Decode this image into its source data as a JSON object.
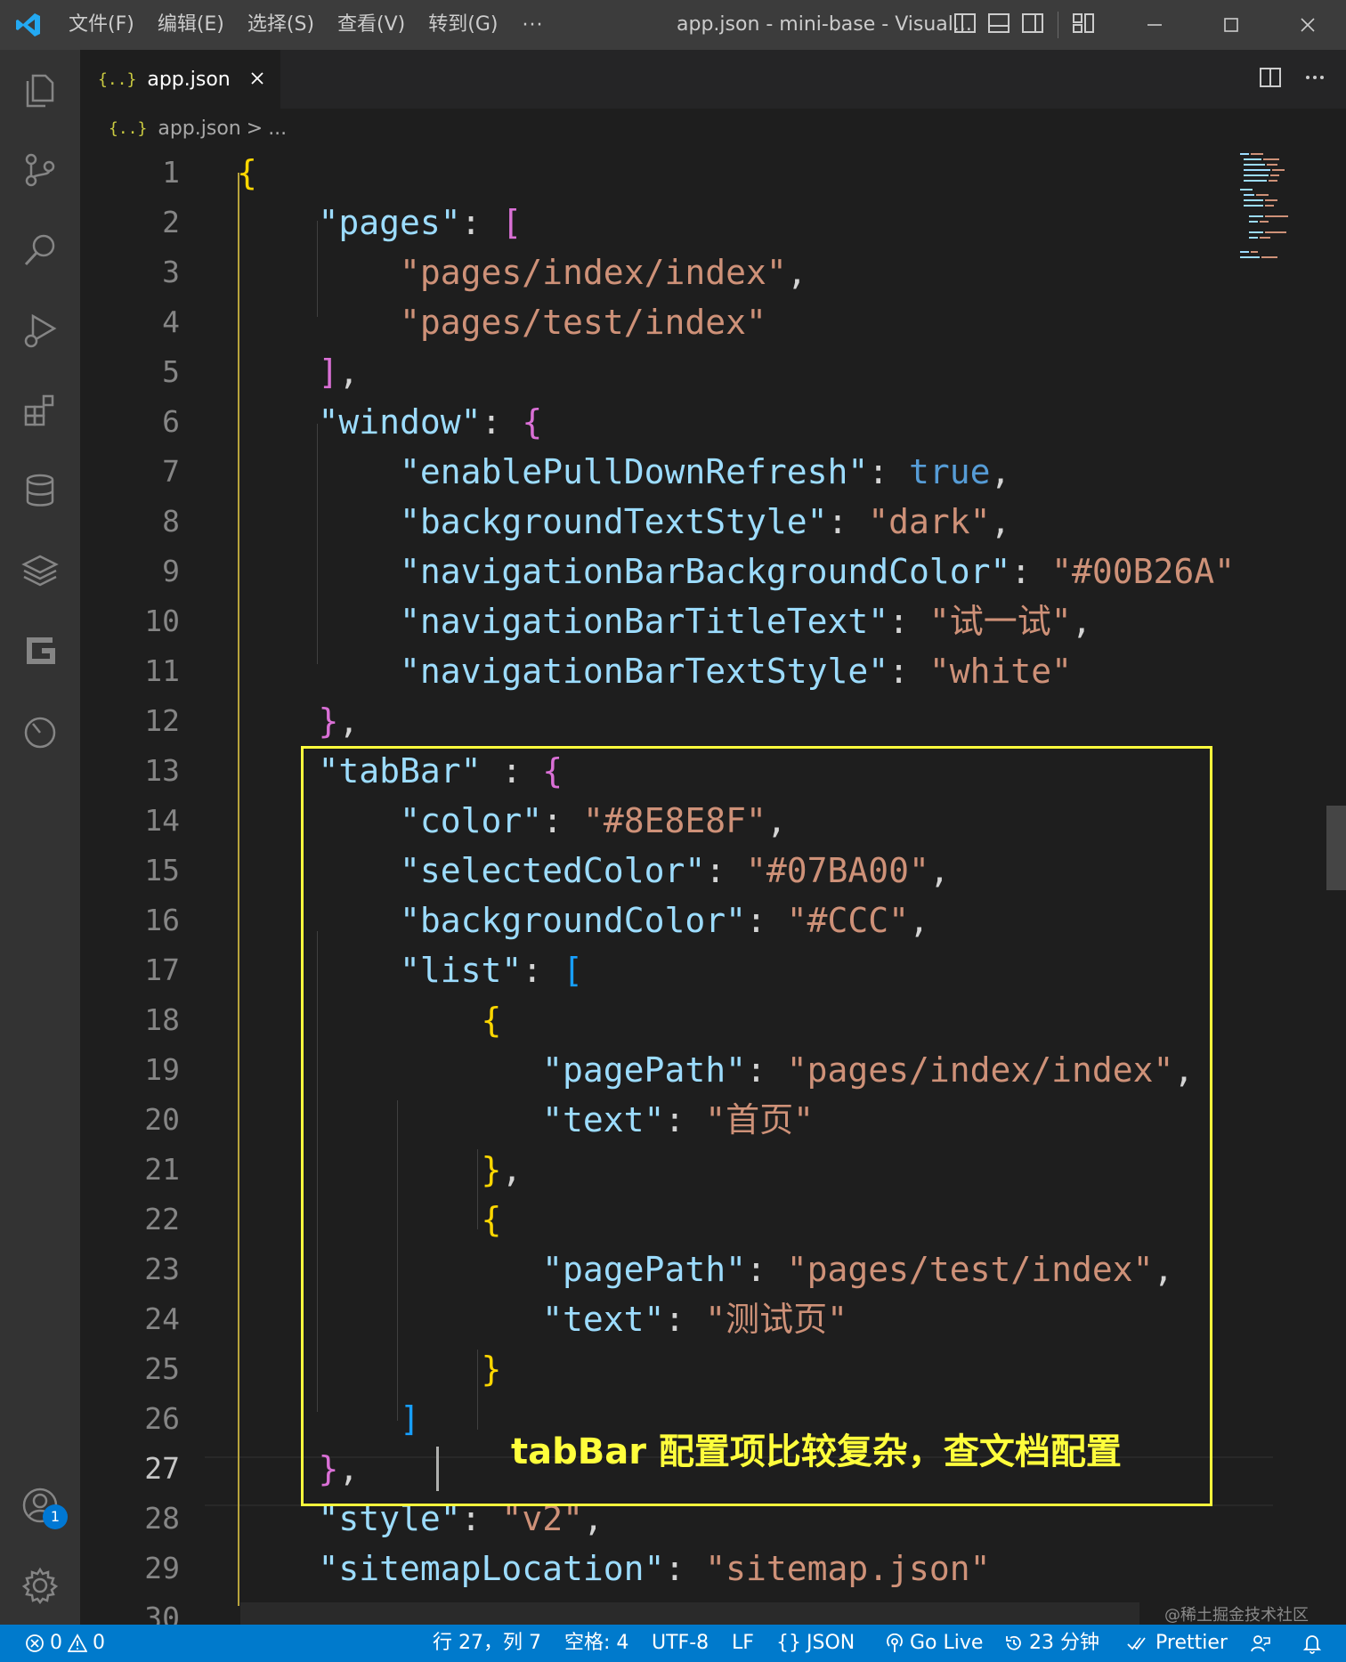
{
  "titlebar": {
    "menus": [
      "文件(F)",
      "编辑(E)",
      "选择(S)",
      "查看(V)",
      "转到(G)"
    ],
    "more": "···",
    "title": "app.json - mini-base - Visual..."
  },
  "tab": {
    "icon": "{..}",
    "label": "app.json"
  },
  "breadcrumb": {
    "icon": "{..}",
    "file": "app.json",
    "separator": ">",
    "ellipsis": "..."
  },
  "editor": {
    "language_colors": {
      "key": "#9cdcfe",
      "string": "#ce9178",
      "bool": "#569cd6"
    },
    "active_line": 27,
    "lines": [
      {
        "n": "1"
      },
      {
        "n": "2"
      },
      {
        "n": "3"
      },
      {
        "n": "4"
      },
      {
        "n": "5"
      },
      {
        "n": "6"
      },
      {
        "n": "7"
      },
      {
        "n": "8"
      },
      {
        "n": "9"
      },
      {
        "n": "10"
      },
      {
        "n": "11"
      },
      {
        "n": "12"
      },
      {
        "n": "13"
      },
      {
        "n": "14"
      },
      {
        "n": "15"
      },
      {
        "n": "16"
      },
      {
        "n": "17"
      },
      {
        "n": "18"
      },
      {
        "n": "19"
      },
      {
        "n": "20"
      },
      {
        "n": "21"
      },
      {
        "n": "22"
      },
      {
        "n": "23"
      },
      {
        "n": "24"
      },
      {
        "n": "25"
      },
      {
        "n": "26"
      },
      {
        "n": "27"
      },
      {
        "n": "28"
      },
      {
        "n": "29"
      },
      {
        "n": "30"
      }
    ],
    "code": {
      "l1": "{",
      "pages_key": "\"pages\"",
      "colon": ": ",
      "open_sq": "[",
      "pages_index": "\"pages/index/index\"",
      "pages_test": "\"pages/test/index\"",
      "close_sq": "]",
      "window_key": "\"window\"",
      "open_cu": "{",
      "close_cu": "}",
      "comma": ",",
      "enable_key": "\"enablePullDownRefresh\"",
      "enable_val": "true",
      "bgts_key": "\"backgroundTextStyle\"",
      "bgts_val": "\"dark\"",
      "nbbg_key": "\"navigationBarBackgroundColor\"",
      "nbbg_val": "\"#00B26A\"",
      "nbtt_key": "\"navigationBarTitleText\"",
      "nbtt_val": "\"试一试\"",
      "nbts_key": "\"navigationBarTextStyle\"",
      "nbts_val": "\"white\"",
      "tabbar_key": "\"tabBar\"",
      "tabbar_colon": " : ",
      "color_key": "\"color\"",
      "color_val": "\"#8E8E8F\"",
      "sel_key": "\"selectedColor\"",
      "sel_val": "\"#07BA00\"",
      "bg_key": "\"backgroundColor\"",
      "bg_val": "\"#CCC\"",
      "list_key": "\"list\"",
      "pagepath_key": "\"pagePath\"",
      "pp1_val": "\"pages/index/index\"",
      "text_key": "\"text\"",
      "text1_val": "\"首页\"",
      "pp2_val": "\"pages/test/index\"",
      "text2_val": "\"测试页\"",
      "style_key": "\"style\"",
      "style_val": "\"v2\"",
      "sitemap_key": "\"sitemapLocation\"",
      "sitemap_val": "\"sitemap.json\"",
      "l30": "}"
    },
    "callout": "tabBar 配置项比较复杂，查文档配置",
    "highlight_color": "#fffe3c"
  },
  "watermark": "@稀土掘金技术社区",
  "activity": {
    "badge": "1"
  },
  "statusbar": {
    "errors": "0",
    "warnings": "0",
    "position": "行 27，列 7",
    "spaces": "空格: 4",
    "encoding": "UTF-8",
    "eol": "LF",
    "language_icon": "{}",
    "language": "JSON",
    "golive": "Go Live",
    "time": "23 分钟",
    "prettier": "Prettier",
    "color": "#007acc"
  }
}
